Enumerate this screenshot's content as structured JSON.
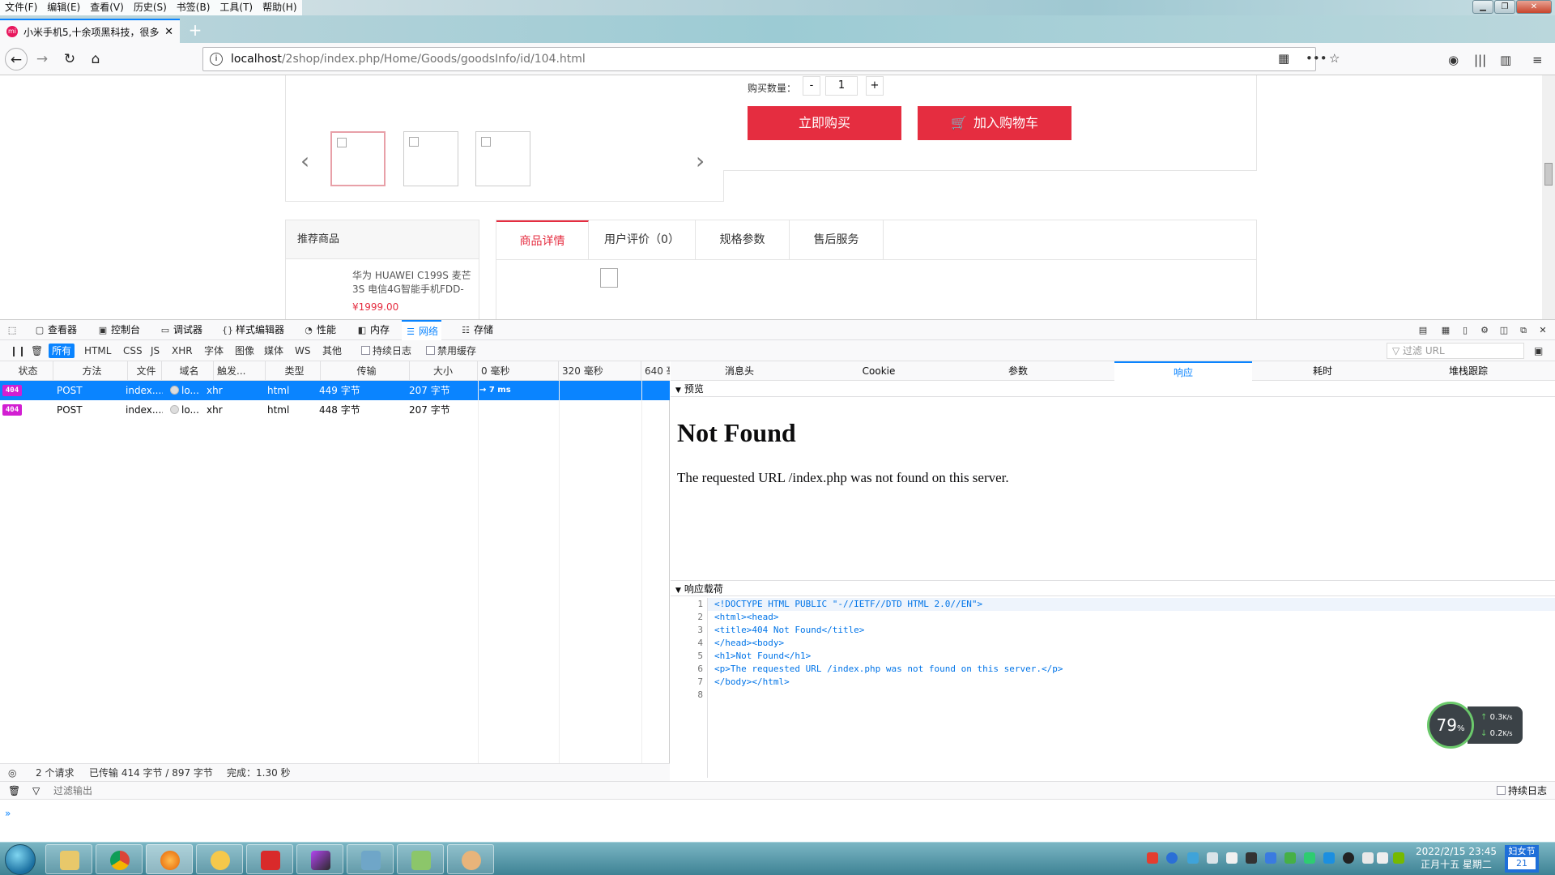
{
  "menu": {
    "items": [
      "文件(F)",
      "编辑(E)",
      "查看(V)",
      "历史(S)",
      "书签(B)",
      "工具(T)",
      "帮助(H)"
    ]
  },
  "tab": {
    "title": "小米手机5,十余项黑科技，很多",
    "favicon_label": "mi",
    "new_tab": "+"
  },
  "nav": {
    "back": "←",
    "forward": "→",
    "reload": "↻",
    "home": "⌂",
    "url_host": "localhost",
    "url_path": "/2shop/index.php/Home/Goods/goodsInfo/id/104.html"
  },
  "product": {
    "qty_label": "购买数量：",
    "qty_minus": "-",
    "qty_value": "1",
    "qty_plus": "+",
    "buy_now": "立即购买",
    "add_cart": "加入购物车",
    "prev": "‹",
    "next": "›",
    "recommend_title": "推荐商品",
    "rec_item_name": "华为 HUAWEI C199S 麦芒3S 电信4G智能手机FDD-",
    "rec_item_price": "¥1999.00",
    "tabs": [
      "商品详情",
      "用户评价（0）",
      "规格参数",
      "售后服务"
    ]
  },
  "devtools": {
    "tabs": [
      "查看器",
      "控制台",
      "调试器",
      "样式编辑器",
      "性能",
      "内存",
      "网络",
      "存储"
    ],
    "active_tab": "网络",
    "filters": [
      "所有",
      "HTML",
      "CSS",
      "JS",
      "XHR",
      "字体",
      "图像",
      "媒体",
      "WS",
      "其他"
    ],
    "persist_log": "持续日志",
    "disable_cache": "禁用缓存",
    "filter_url_placeholder": "过滤 URL",
    "columns": [
      "状态",
      "方法",
      "文件",
      "域名",
      "触发...",
      "类型",
      "传输",
      "大小",
      "0 毫秒",
      "320 毫秒",
      "640 毫"
    ],
    "rows": [
      {
        "status": "404",
        "method": "POST",
        "file": "index....",
        "domain": "lo...",
        "cause": "xhr",
        "type": "html",
        "transferred": "449 字节",
        "size": "207 字节",
        "timing": "→ 7 ms",
        "selected": true
      },
      {
        "status": "404",
        "method": "POST",
        "file": "index....",
        "domain": "lo...",
        "cause": "xhr",
        "type": "html",
        "transferred": "448 字节",
        "size": "207 字节",
        "timing": "",
        "selected": false
      }
    ],
    "summary_requests": "2 个请求",
    "summary_transferred": "已传输 414 字节 / 897 字节",
    "summary_finish": "完成：1.30 秒",
    "detail_tabs": [
      "消息头",
      "Cookie",
      "参数",
      "响应",
      "耗时",
      "堆栈跟踪"
    ],
    "active_detail_tab": "响应",
    "preview_label": "预览",
    "preview_h1": "Not Found",
    "preview_p": "The requested URL /index.php was not found on this server.",
    "payload_label": "响应载荷",
    "code_lines": [
      "<!DOCTYPE HTML PUBLIC \"-//IETF//DTD HTML 2.0//EN\">",
      "<html><head>",
      "<title>404 Not Found</title>",
      "</head><body>",
      "<h1>Not Found</h1>",
      "<p>The requested URL /index.php was not found on this server.</p>",
      "</body></html>",
      ""
    ],
    "console_filter": "过滤输出",
    "console_persist": "持续日志",
    "console_prompt": "»"
  },
  "speed": {
    "percent": "79",
    "pct_sign": "%",
    "up": "0.3",
    "down": "0.2",
    "unit": "K/s"
  },
  "taskbar": {
    "date_time": "2022/2/15 23:45",
    "lunar": "正月十五 星期二",
    "ime_top": "妇女节",
    "ime_bottom": "21"
  },
  "colors": {
    "accent": "#0a84ff",
    "brand_red": "#e52d40",
    "status_404": "#d21fd2"
  }
}
